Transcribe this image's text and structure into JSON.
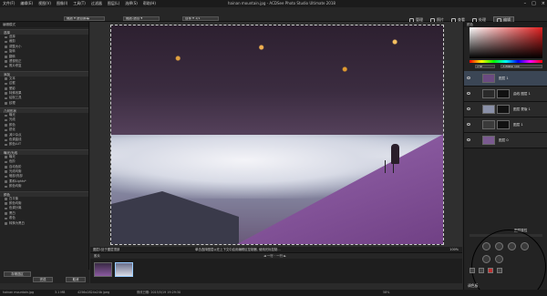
{
  "window": {
    "title": "hainan mountain.jpg - ACDSee Photo Studio Ultimate 2018",
    "menu": [
      "文件(F)",
      "编辑(E)",
      "视图(V)",
      "图像(I)",
      "工具(T)",
      "过滤器",
      "图层(L)",
      "选择(S)",
      "帮助(H)"
    ]
  },
  "toolbar": {
    "zoom_field": "缩放 ▾ 适合屏幕",
    "layer_field": "缩放-适合 ▾",
    "mode_field": "目标 ▾ 1/1",
    "modes": [
      "管理",
      "照片",
      "查看",
      "处理",
      "编辑"
    ]
  },
  "left_panel": {
    "title": "编辑模式",
    "groups": [
      {
        "title": "选择",
        "items": [
          "选择",
          "裁剪",
          "调整大小",
          "旋转",
          "翻转",
          "透视校正",
          "照片修复"
        ]
      },
      {
        "title": "添加",
        "items": [
          "文本",
          "边框",
          "晕影",
          "特殊效果",
          "绘制工具",
          "纹理"
        ]
      },
      {
        "title": "几何形状",
        "items": [
          "曝光",
          "光线",
          "颜色",
          "锐化",
          "减少杂点",
          "色调曲线",
          "颜色LUT"
        ]
      },
      {
        "title": "曝光/光线",
        "items": [
          "曝光",
          "色阶",
          "自动色阶",
          "光线均衡",
          "暗部/亮部",
          "柔和Lights*",
          "颜色均衡"
        ]
      },
      {
        "title": "颜色",
        "items": [
          "白平衡",
          "颜色均衡",
          "色调分离",
          "黑白",
          "着色",
          "转换为黑白"
        ]
      }
    ],
    "footer": {
      "button_save_selection": "存储选区",
      "button_done": "完成",
      "button_cancel": "取消"
    }
  },
  "canvas": {
    "status_left": "图层1处于图层顶部",
    "status_center": "单击选择图层以在上下文中启用编辑区控制器, 使用光标控制…",
    "status_zoom": "100%"
  },
  "filmstrip": {
    "label": "胶片",
    "nav": "◄ 一行 · 一行 ►"
  },
  "statusbar": {
    "file": "hainan mountain.jpg",
    "size": "3.1 MB",
    "dims": "4256x2824x24b jpeg",
    "date": "修改日期: 2015/5/19 19:29:30",
    "zoom": "58%"
  },
  "right_panel": {
    "title": "颜色",
    "blend_mode": "正常",
    "opacity": "不透明度 100",
    "layers": [
      {
        "name": "图层 1",
        "active": true,
        "thumb_color": "#6a4a80",
        "mask": false
      },
      {
        "name": "曲线 图层 1",
        "active": false,
        "thumb_color": "#2a2a2a",
        "mask": true
      },
      {
        "name": "图层 蒙版 1",
        "active": false,
        "thumb_color": "#8a90a8",
        "mask": true
      },
      {
        "name": "图层 1",
        "active": false,
        "thumb_color": "#3a3a3a",
        "mask": true
      },
      {
        "name": "图层 0",
        "active": false,
        "thumb_color": "#7a5a90",
        "mask": false
      }
    ],
    "props_title": "图层属性",
    "bottom_label": "调色板"
  }
}
